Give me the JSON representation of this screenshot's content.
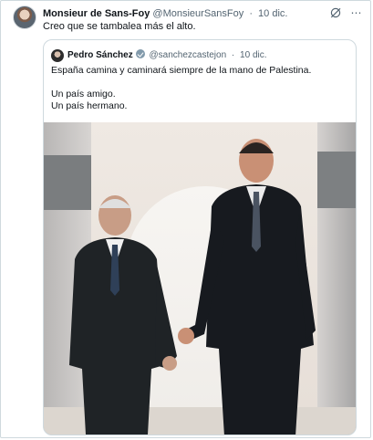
{
  "tweet": {
    "author_name": "Monsieur de Sans-Foy",
    "author_handle": "@MonsieurSansFoy",
    "separator": "·",
    "date": "10 dic.",
    "text": "Creo que se tambalea más el alto."
  },
  "quoted": {
    "author_name": "Pedro Sánchez",
    "author_handle": "@sanchezcastejon",
    "separator": "·",
    "date": "10 dic.",
    "line1": "España camina y caminará siempre de la mano de Palestina.",
    "line2": "Un país amigo.",
    "line3": "Un país hermano."
  },
  "icons": {
    "grok": "grok-icon",
    "more": "more-icon",
    "verified": "verified-badge-icon"
  },
  "colors": {
    "text": "#0f1419",
    "muted": "#536471",
    "border": "#cfd9de",
    "verified_badge": "#829aab"
  }
}
